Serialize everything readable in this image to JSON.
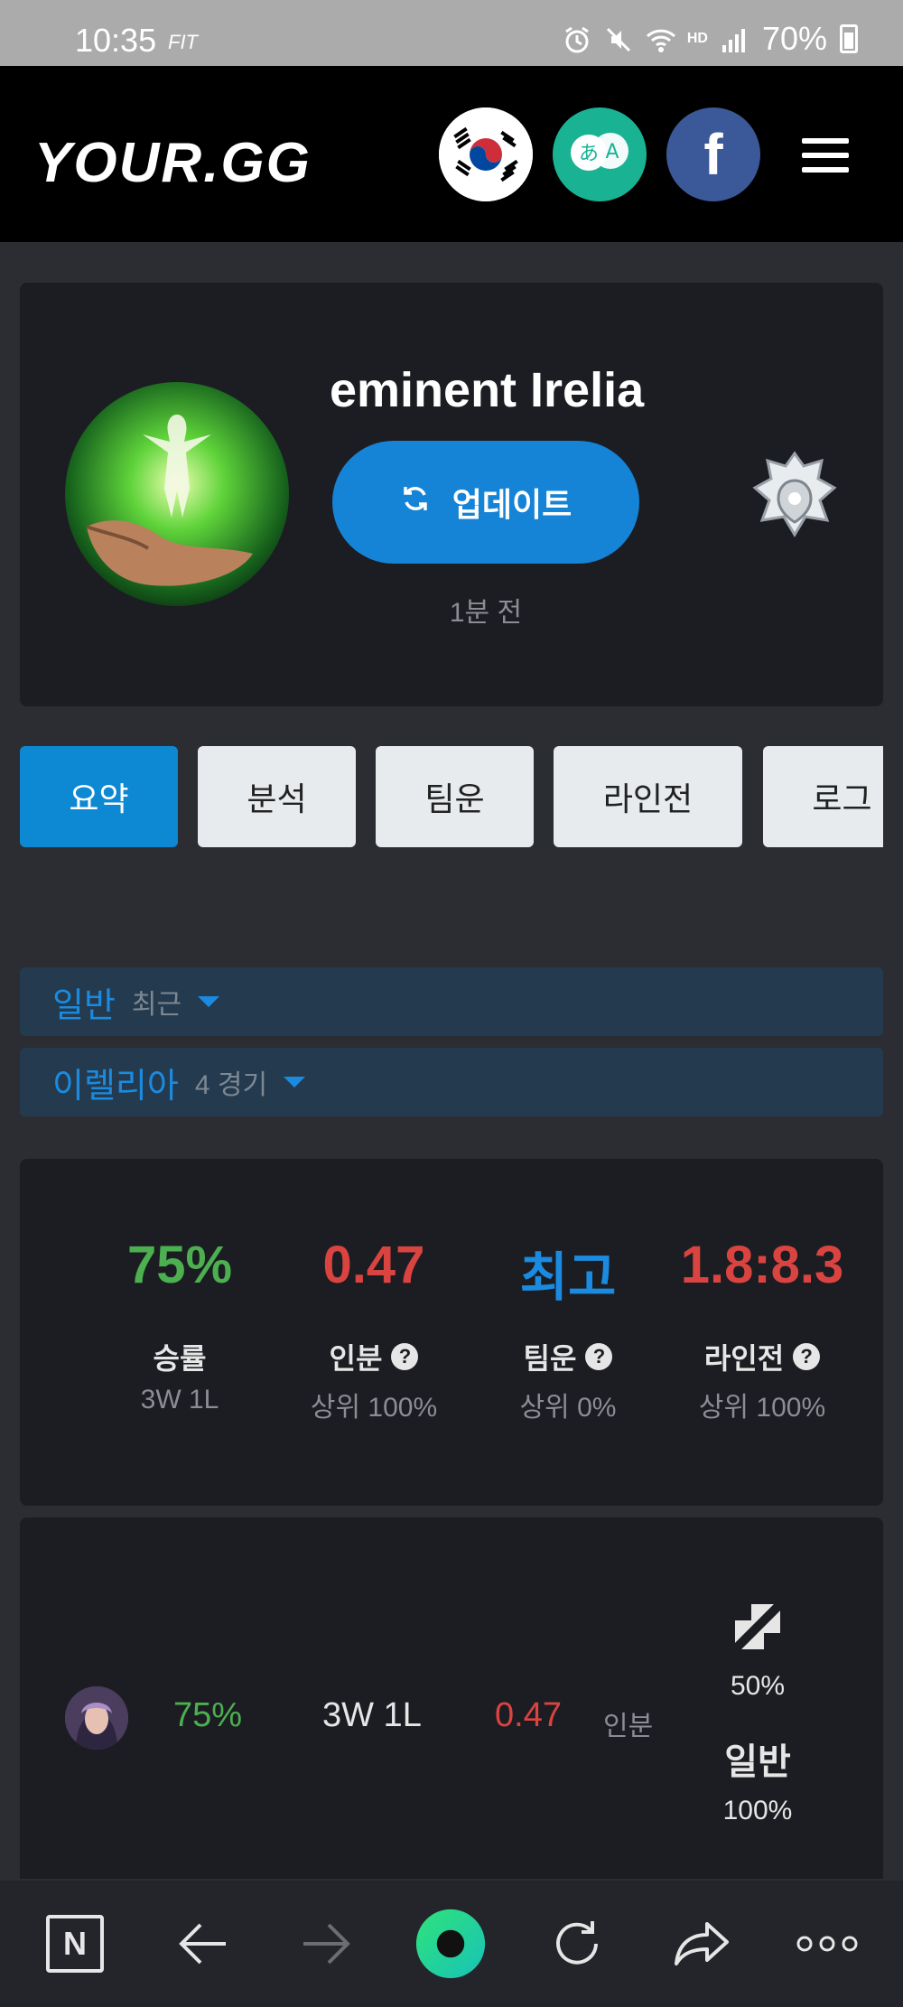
{
  "status_bar": {
    "time": "10:35",
    "fit_label": "FIT",
    "hd_label": "HD",
    "battery": "70%"
  },
  "header": {
    "logo": "YOUR.GG",
    "region_icon": "korea-flag-icon",
    "translate_icon": "translate-icon",
    "translate_glyphs": [
      "あ",
      "A"
    ],
    "facebook_label": "f"
  },
  "profile": {
    "name": "eminent Irelia",
    "update_label": "업데이트",
    "updated_ago": "1분 전",
    "rank_icon": "rank-emblem-icon"
  },
  "tabs": [
    {
      "label": "요약",
      "active": true
    },
    {
      "label": "분석",
      "active": false
    },
    {
      "label": "팀운",
      "active": false
    },
    {
      "label": "라인전",
      "active": false
    },
    {
      "label": "로그",
      "active": false
    }
  ],
  "filters": {
    "mode": {
      "label": "일반",
      "sub": "최근"
    },
    "champion": {
      "label": "이렐리아",
      "sub": "4 경기"
    }
  },
  "stats": [
    {
      "value": "75%",
      "label": "승률",
      "sub": "3W 1L",
      "color": "#4caf50",
      "help": false
    },
    {
      "value": "0.47",
      "label": "인분",
      "sub": "상위 100%",
      "color": "#d94441",
      "help": true
    },
    {
      "value": "최고",
      "label": "팀운",
      "sub": "상위 0%",
      "color": "#1a8be0",
      "help": true
    },
    {
      "value": "1.8:8.3",
      "label": "라인전",
      "sub": "상위 100%",
      "color": "#d94441",
      "help": true
    }
  ],
  "help_glyph": "?",
  "champ_row": {
    "winrate": "75%",
    "record": "3W 1L",
    "score": "0.47",
    "score_label": "인분",
    "position_pct": "50%",
    "mode_label": "일반",
    "mode_pct": "100%"
  },
  "nav": {
    "n_label": "N"
  },
  "colors": {
    "accent": "#1583d6",
    "win": "#4caf50",
    "loss": "#d94441",
    "background": "#2c2d33",
    "card": "#1c1d22"
  }
}
